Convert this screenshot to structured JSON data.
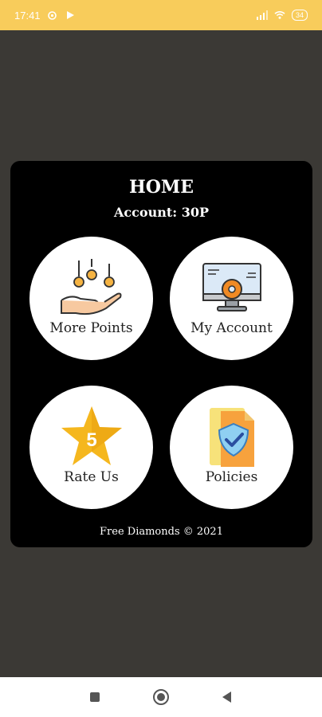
{
  "status_bar": {
    "time": "17:41",
    "battery": "34"
  },
  "home": {
    "title": "HOME",
    "account": "Account: 30P",
    "tiles": [
      {
        "label": "More Points",
        "icon": "coins-hand-icon"
      },
      {
        "label": "My Account",
        "icon": "monitor-gear-icon"
      },
      {
        "label": "Rate Us",
        "icon": "star-icon",
        "star_number": "5"
      },
      {
        "label": "Policies",
        "icon": "shield-document-icon"
      }
    ],
    "footer": "Free Diamonds © 2021"
  },
  "colors": {
    "status_bar": "#f8cc5b",
    "background": "#3b3935",
    "card": "#000000",
    "tile": "#ffffff",
    "star": "#f5b71e"
  }
}
